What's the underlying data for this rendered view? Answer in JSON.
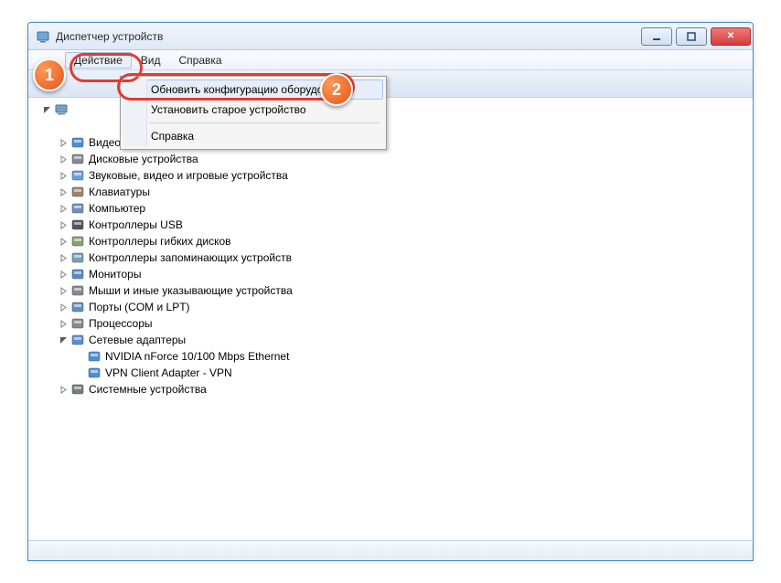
{
  "window": {
    "title": "Диспетчер устройств"
  },
  "menubar": {
    "action": "Действие",
    "view": "Вид",
    "help": "Справка"
  },
  "dropdown": {
    "scan": "Обновить конфигурацию оборудования",
    "legacy": "Установить старое устройство",
    "help": "Справка"
  },
  "tree": {
    "items": [
      {
        "label": "Видеоадаптеры",
        "indent": 1,
        "exp": "closed",
        "icon": "display"
      },
      {
        "label": "Дисковые устройства",
        "indent": 1,
        "exp": "closed",
        "icon": "disk"
      },
      {
        "label": "Звуковые, видео и игровые устройства",
        "indent": 1,
        "exp": "closed",
        "icon": "sound"
      },
      {
        "label": "Клавиатуры",
        "indent": 1,
        "exp": "closed",
        "icon": "keyboard"
      },
      {
        "label": "Компьютер",
        "indent": 1,
        "exp": "closed",
        "icon": "computer"
      },
      {
        "label": "Контроллеры USB",
        "indent": 1,
        "exp": "closed",
        "icon": "usb"
      },
      {
        "label": "Контроллеры гибких дисков",
        "indent": 1,
        "exp": "closed",
        "icon": "floppy"
      },
      {
        "label": "Контроллеры запоминающих устройств",
        "indent": 1,
        "exp": "closed",
        "icon": "storage"
      },
      {
        "label": "Мониторы",
        "indent": 1,
        "exp": "closed",
        "icon": "monitor"
      },
      {
        "label": "Мыши и иные указывающие устройства",
        "indent": 1,
        "exp": "closed",
        "icon": "mouse"
      },
      {
        "label": "Порты (COM и LPT)",
        "indent": 1,
        "exp": "closed",
        "icon": "port"
      },
      {
        "label": "Процессоры",
        "indent": 1,
        "exp": "closed",
        "icon": "cpu"
      },
      {
        "label": "Сетевые адаптеры",
        "indent": 1,
        "exp": "open",
        "icon": "network"
      },
      {
        "label": "NVIDIA nForce 10/100 Mbps Ethernet",
        "indent": 2,
        "exp": "none",
        "icon": "nic"
      },
      {
        "label": "VPN Client Adapter - VPN",
        "indent": 2,
        "exp": "none",
        "icon": "nic"
      },
      {
        "label": "Системные устройства",
        "indent": 1,
        "exp": "closed",
        "icon": "system"
      }
    ]
  },
  "callouts": {
    "c1": "1",
    "c2": "2"
  },
  "icons": {
    "display": "#4a90d9",
    "disk": "#8a8a8a",
    "sound": "#6aa0d8",
    "keyboard": "#9a8666",
    "computer": "#6f91b8",
    "usb": "#555",
    "floppy": "#8aa06a",
    "storage": "#7aa0b8",
    "monitor": "#5a89c7",
    "mouse": "#888",
    "port": "#5f8fc0",
    "cpu": "#8a8a8a",
    "network": "#5a8fd0",
    "nic": "#4f90d8",
    "system": "#7a7a7a"
  }
}
